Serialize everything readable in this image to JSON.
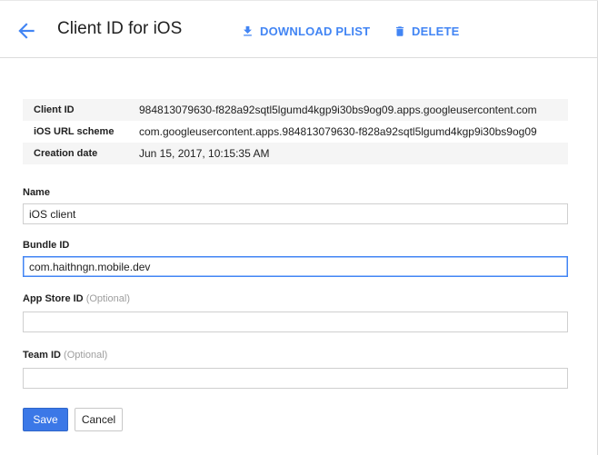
{
  "header": {
    "title": "Client ID for iOS",
    "download_label": "DOWNLOAD PLIST",
    "delete_label": "DELETE"
  },
  "info": [
    {
      "label": "Client ID",
      "value": "984813079630-f828a92sqtl5lgumd4kgp9i30bs9og09.apps.googleusercontent.com"
    },
    {
      "label": "iOS URL scheme",
      "value": "com.googleusercontent.apps.984813079630-f828a92sqtl5lgumd4kgp9i30bs9og09"
    },
    {
      "label": "Creation date",
      "value": "Jun 15, 2017, 10:15:35 AM"
    }
  ],
  "form": {
    "name": {
      "label": "Name",
      "value": "iOS client"
    },
    "bundle_id": {
      "label": "Bundle ID",
      "value": "com.haithngn.mobile.dev"
    },
    "app_store_id": {
      "label": "App Store ID",
      "optional": "(Optional)",
      "value": ""
    },
    "team_id": {
      "label": "Team ID",
      "optional": "(Optional)",
      "value": ""
    }
  },
  "buttons": {
    "save": "Save",
    "cancel": "Cancel"
  },
  "colors": {
    "accent": "#4285f4",
    "primary_button": "#3b78e7"
  },
  "icons": {
    "back": "arrow-back-icon",
    "download": "download-icon",
    "delete": "trash-icon"
  }
}
